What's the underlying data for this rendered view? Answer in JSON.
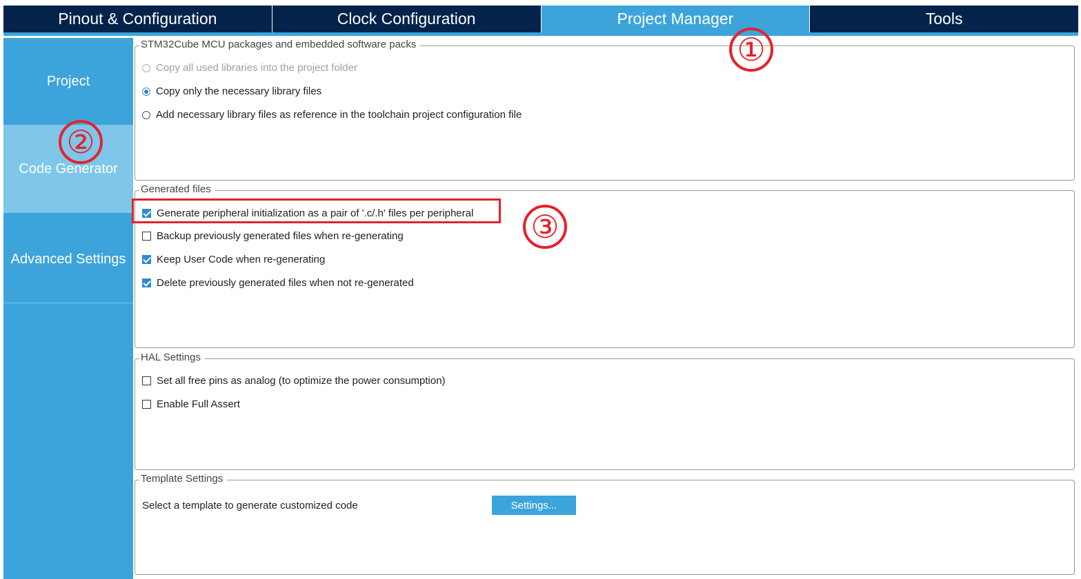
{
  "tabs": {
    "pinout": "Pinout & Configuration",
    "clock": "Clock Configuration",
    "project_manager": "Project Manager",
    "tools": "Tools"
  },
  "sidebar": {
    "project": "Project",
    "code_generator": "Code Generator",
    "advanced": "Advanced Settings"
  },
  "mcu_packages": {
    "legend": "STM32Cube MCU packages and embedded software packs",
    "options": [
      "Copy all used libraries into the project folder",
      "Copy only the necessary library files",
      "Add necessary library files as reference in the toolchain project configuration file"
    ]
  },
  "generated_files": {
    "legend": "Generated files",
    "options": [
      "Generate peripheral initialization as a pair of '.c/.h' files per peripheral",
      "Backup previously generated files when re-generating",
      "Keep User Code when re-generating",
      "Delete previously generated files when not re-generated"
    ]
  },
  "hal_settings": {
    "legend": "HAL Settings",
    "options": [
      "Set all free pins as analog (to optimize the power consumption)",
      "Enable Full Assert"
    ]
  },
  "template_settings": {
    "legend": "Template Settings",
    "text": "Select a template to generate customized code",
    "button": "Settings..."
  },
  "annotations": {
    "m1": "①",
    "m2": "②",
    "m3": "③"
  },
  "colors": {
    "nav_dark": "#03234b",
    "accent": "#3ca4db",
    "sidebar_active": "#7ec7ea",
    "annotation_red": "#e8202a"
  }
}
